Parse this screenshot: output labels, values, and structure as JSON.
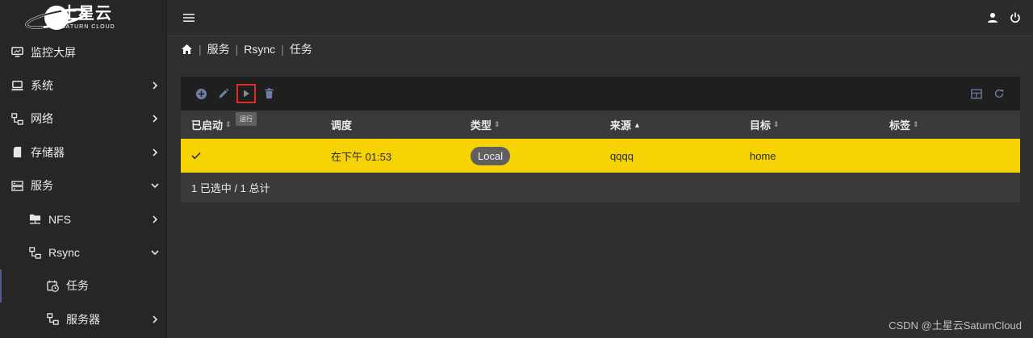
{
  "brand": {
    "name_cn": "土星云",
    "name_en": "SATURN CLOUD"
  },
  "sidebar": {
    "items": [
      {
        "label": "监控大屏",
        "icon": "monitor-icon"
      },
      {
        "label": "系统",
        "icon": "computer-icon",
        "chevron": "right"
      },
      {
        "label": "网络",
        "icon": "network-icon",
        "chevron": "right"
      },
      {
        "label": "存储器",
        "icon": "sd-card-icon",
        "chevron": "right"
      },
      {
        "label": "服务",
        "icon": "server-icon",
        "chevron": "down"
      },
      {
        "label": "NFS",
        "icon": "folder-network-icon",
        "chevron": "right"
      },
      {
        "label": "Rsync",
        "icon": "network-icon",
        "chevron": "down"
      },
      {
        "label": "任务",
        "icon": "calendar-clock-icon"
      },
      {
        "label": "服务器",
        "icon": "network-icon",
        "chevron": "right"
      }
    ]
  },
  "topbar": {
    "menu_icon": "hamburger-icon",
    "user_icon": "user-icon",
    "power_icon": "power-icon"
  },
  "breadcrumb": {
    "home_icon": "home-icon",
    "items": [
      "服务",
      "Rsync",
      "任务"
    ]
  },
  "toolbar": {
    "buttons": [
      "add-icon",
      "edit-icon",
      "play-icon",
      "delete-icon"
    ],
    "right_buttons": [
      "columns-icon",
      "refresh-icon"
    ],
    "tooltip": "运行"
  },
  "table": {
    "columns": [
      "已启动",
      "调度",
      "类型",
      "来源",
      "目标",
      "标签"
    ],
    "sort_column": "来源",
    "rows": [
      {
        "enabled": "✓",
        "schedule": "在下午 01:53",
        "type": "Local",
        "source": "qqqq",
        "target": "home",
        "tags": ""
      }
    ],
    "footer": "1 已选中 / 1 总计"
  },
  "colors": {
    "selected_row": "#f5d304",
    "highlight_border": "#e02b2b",
    "accent": "#555c8a"
  },
  "watermark": "CSDN @土星云SaturnCloud"
}
